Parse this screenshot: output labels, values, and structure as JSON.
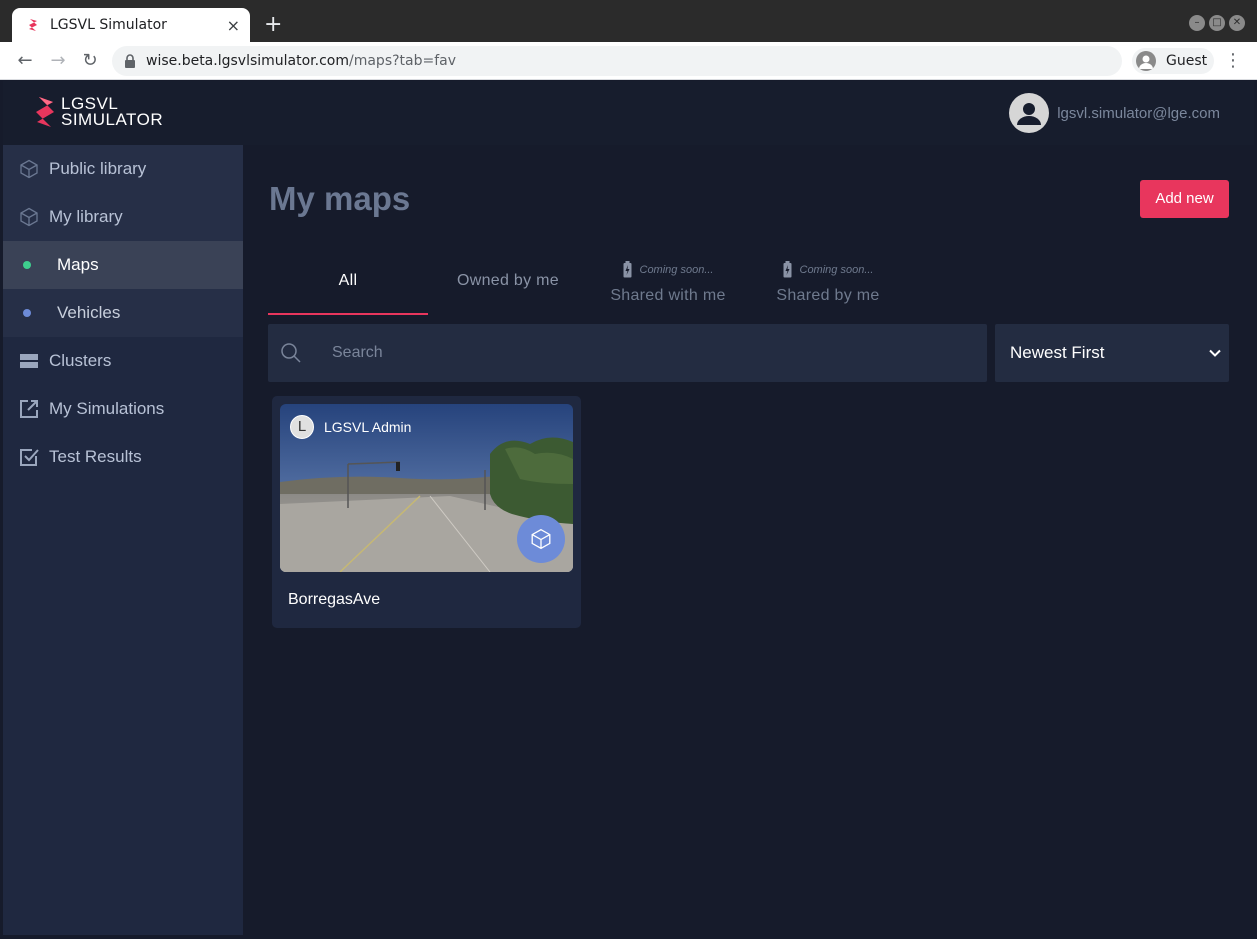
{
  "browser": {
    "tab_title": "LGSVL Simulator",
    "tab_close": "×",
    "new_tab": "+",
    "url_host": "wise.beta.lgsvlsimulator.com",
    "url_path": "/maps?tab=fav",
    "profile_label": "Guest"
  },
  "header": {
    "logo_line1": "LGSVL",
    "logo_line2": "SIMULATOR",
    "user_email": "lgsvl.simulator@lge.com"
  },
  "sidebar": {
    "items": [
      {
        "label": "Public library",
        "icon": "cube-icon"
      },
      {
        "label": "My library",
        "icon": "cube-icon"
      },
      {
        "label": "Maps",
        "dot_color": "#3ecf8e"
      },
      {
        "label": "Vehicles",
        "dot_color": "#6d8bd8"
      },
      {
        "label": "Clusters",
        "icon": "server-icon"
      },
      {
        "label": "My Simulations",
        "icon": "external-link-icon"
      },
      {
        "label": "Test Results",
        "icon": "checkbox-icon"
      }
    ]
  },
  "main": {
    "title": "My maps",
    "add_button": "Add new",
    "tabs": [
      {
        "label": "All",
        "active": true
      },
      {
        "label": "Owned by me"
      },
      {
        "label": "Shared with me",
        "note": "Coming soon..."
      },
      {
        "label": "Shared by me",
        "note": "Coming soon..."
      }
    ],
    "search": {
      "placeholder": "Search",
      "value": ""
    },
    "sort": {
      "selected": "Newest First"
    },
    "cards": [
      {
        "name": "BorregasAve",
        "owner": "LGSVL Admin",
        "owner_initial": "L"
      }
    ]
  },
  "colors": {
    "accent": "#e8365d",
    "sidebar_bg": "#1f2840",
    "main_bg": "#161b2b"
  }
}
